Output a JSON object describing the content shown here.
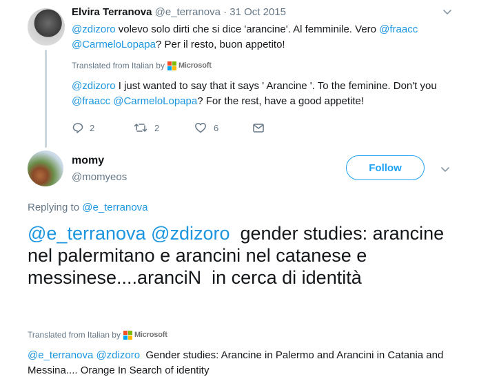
{
  "tweet1": {
    "name": "Elvira Terranova",
    "handle": "@e_terranova",
    "date": "· 31 Oct 2015",
    "body": {
      "m1": "@zdizoro",
      "t1": " volevo solo dirti che si dice 'arancine'. Al femminile. Vero ",
      "m2": "@fraacc",
      "m3": "@CarmeloLopapa",
      "t2": "? Per il resto, buon appetito!"
    },
    "translated_label": "Translated from Italian by",
    "microsoft": "Microsoft",
    "translation": {
      "m1": "@zdizoro",
      "t1": " I just wanted to say that it says ' Arancine '. To the feminine. Don't you",
      "m2": "@fraacc",
      "m3": "@CarmeloLopapa",
      "t2": "? For the rest, have a good appetite!"
    },
    "actions": {
      "replies": "2",
      "retweets": "2",
      "likes": "6"
    }
  },
  "tweet2": {
    "name": "momy",
    "handle": "@momyeos",
    "follow_label": "Follow",
    "replying_prefix": "Replying to",
    "replying_to": "@e_terranova",
    "body": {
      "m1": "@e_terranova",
      "m2": "@zdizoro",
      "t1": "  gender studies: arancine nel palermitano e arancini nel catanese e messinese....aranciN  in cerca di identità"
    },
    "translated_label": "Translated from Italian by",
    "microsoft": "Microsoft",
    "translation": {
      "m1": "@e_terranova",
      "m2": "@zdizoro",
      "t1": "  Gender studies: Arancine in Palermo and Arancini in Catania and Messina.... Orange In Search of identity"
    }
  },
  "colors": {
    "accent": "#1b95e0",
    "follow": "#1da1f2",
    "muted": "#657786",
    "thread": "#ccd6dd"
  }
}
